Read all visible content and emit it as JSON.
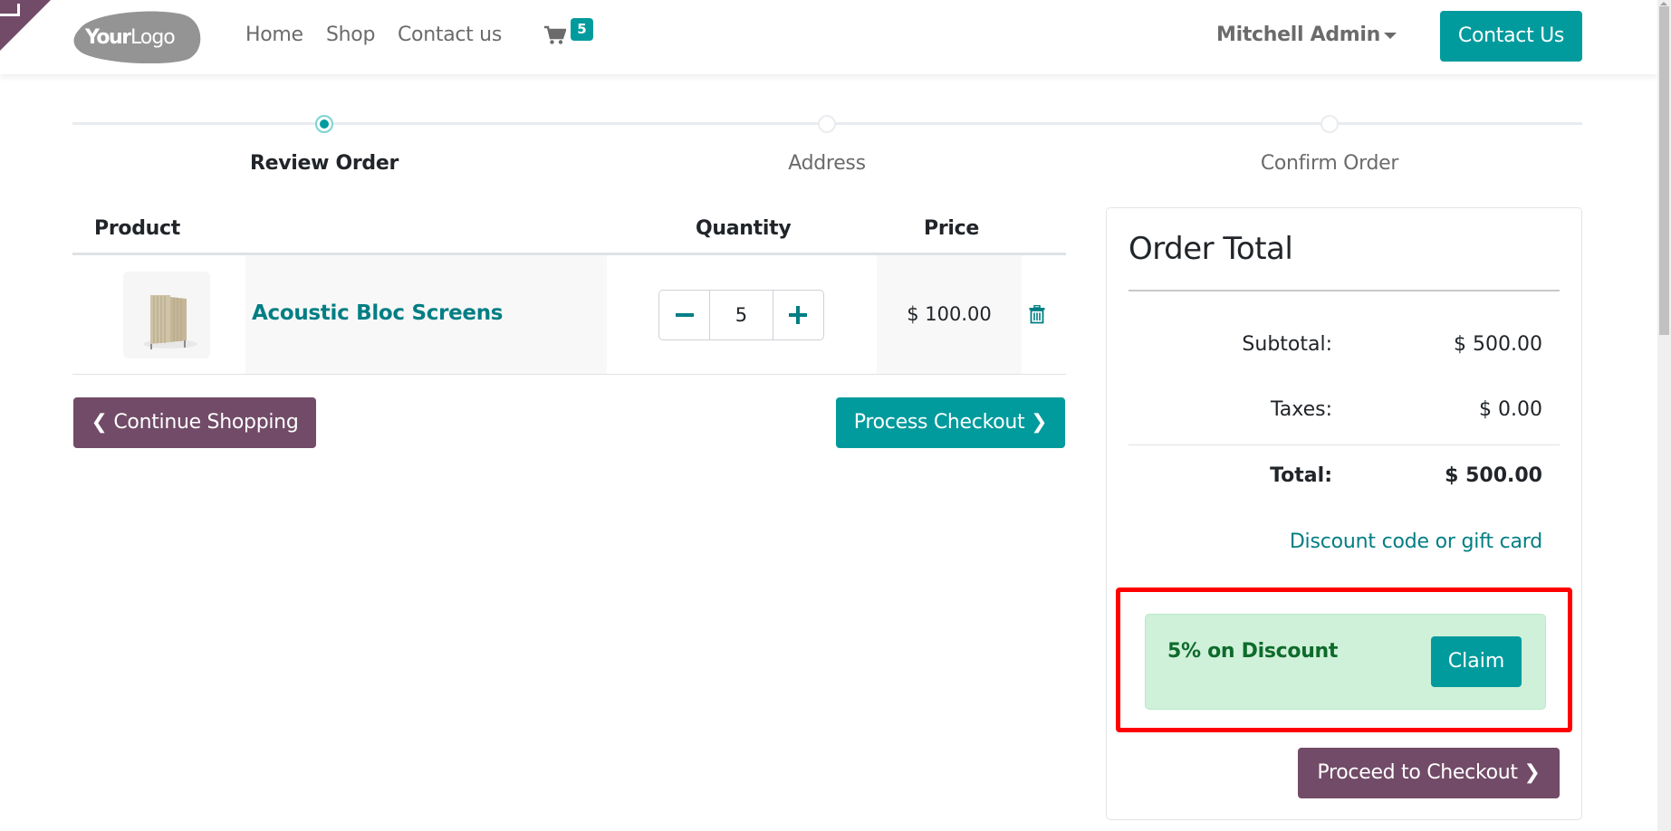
{
  "navbar": {
    "logo_alt": "YourLogo",
    "logo_text_bold": "Your",
    "logo_text_light": "Logo",
    "links": [
      "Home",
      "Shop",
      "Contact us"
    ],
    "cart_count": "5",
    "user_name": "Mitchell Admin",
    "contact_button": "Contact Us"
  },
  "wizard": {
    "steps": [
      {
        "label": "Review Order",
        "active": true
      },
      {
        "label": "Address",
        "active": false
      },
      {
        "label": "Confirm Order",
        "active": false
      }
    ]
  },
  "cart": {
    "headers": {
      "product": "Product",
      "quantity": "Quantity",
      "price": "Price"
    },
    "lines": [
      {
        "name": "Acoustic Bloc Screens",
        "quantity": "5",
        "price": "$ 100.00"
      }
    ],
    "continue_button": "Continue Shopping",
    "checkout_button": "Process Checkout"
  },
  "order_total": {
    "title": "Order Total",
    "subtotal_label": "Subtotal:",
    "subtotal_value": "$ 500.00",
    "taxes_label": "Taxes:",
    "taxes_value": "$ 0.00",
    "total_label": "Total:",
    "total_value": "$ 500.00",
    "discount_link": "Discount code or gift card",
    "promo": {
      "text": "5% on Discount",
      "claim_button": "Claim"
    },
    "proceed_button": "Proceed to Checkout"
  },
  "colors": {
    "primary": "#019b9d",
    "secondary": "#714b67",
    "link": "#017e84",
    "highlight": "#ff0000",
    "promo_bg": "#cff0d9"
  }
}
